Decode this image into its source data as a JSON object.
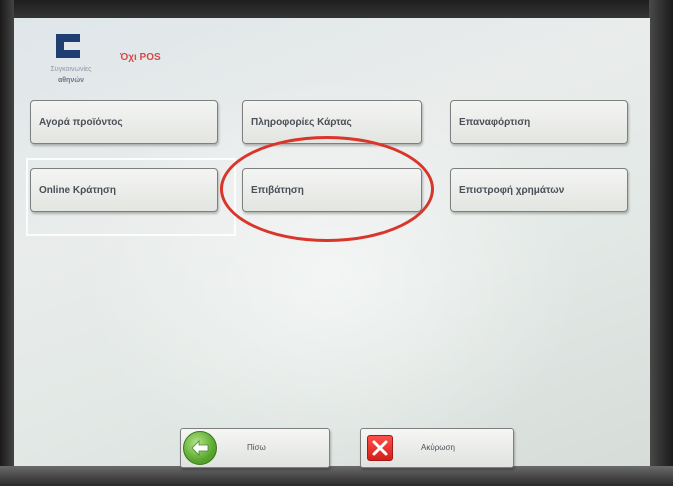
{
  "header": {
    "logo_line1": "Συγκοινωνίες",
    "logo_line2": "αθηνών",
    "mode_label": "Όχι POS"
  },
  "menu": {
    "buy_product": "Αγορά προϊόντος",
    "card_info": "Πληροφορίες Κάρτας",
    "recharge": "Επαναφόρτιση",
    "online_booking": "Online Κράτηση",
    "validation": "Επιβάτηση",
    "refund": "Επιστροφή χρημάτων"
  },
  "footer": {
    "back_label": "Πίσω",
    "cancel_label": "Ακύρωση"
  },
  "colors": {
    "annotation_red": "#d8352b",
    "logo_blue": "#1f3e72",
    "mode_red": "#d44a4a"
  },
  "icons": {
    "back": "back-arrow-icon",
    "cancel": "close-icon",
    "logo": "oasa-logo-icon"
  }
}
